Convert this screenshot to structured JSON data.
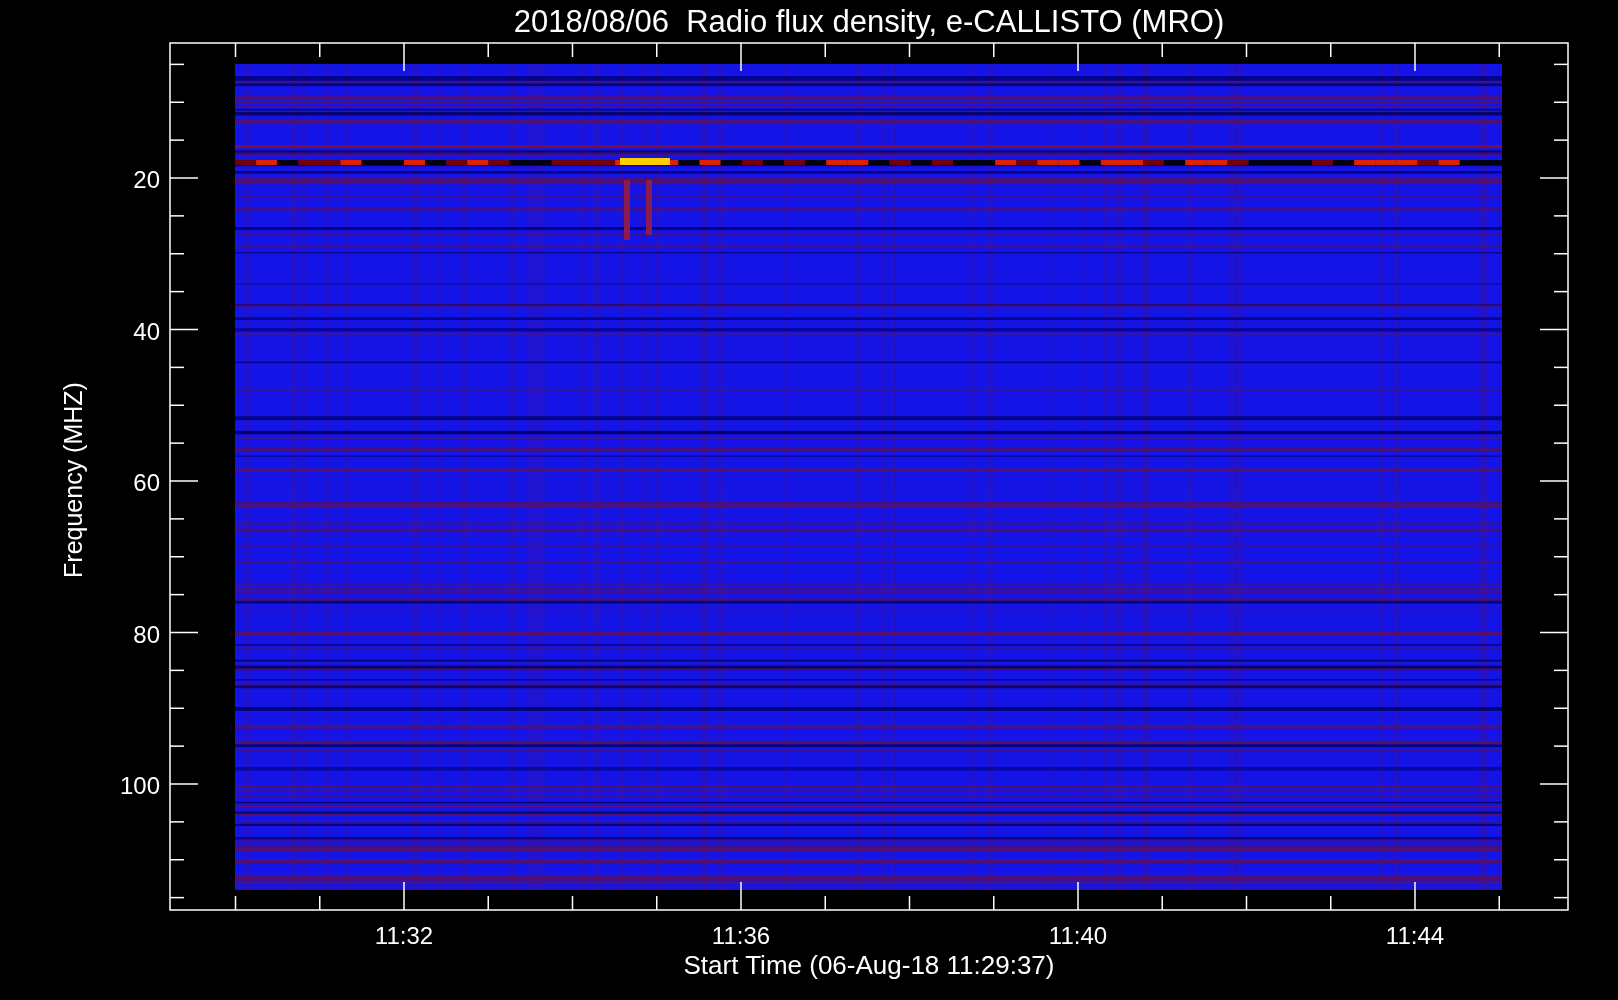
{
  "title": "2018/08/06  Radio flux density, e-CALLISTO (MRO)",
  "ylabel": "Frequency (MHZ)",
  "xlabel": "Start Time (06-Aug-18 11:29:37)",
  "yticks": [
    "20",
    "40",
    "60",
    "80",
    "100"
  ],
  "xticks": [
    "11:32",
    "11:36",
    "11:40",
    "11:44"
  ]
}
